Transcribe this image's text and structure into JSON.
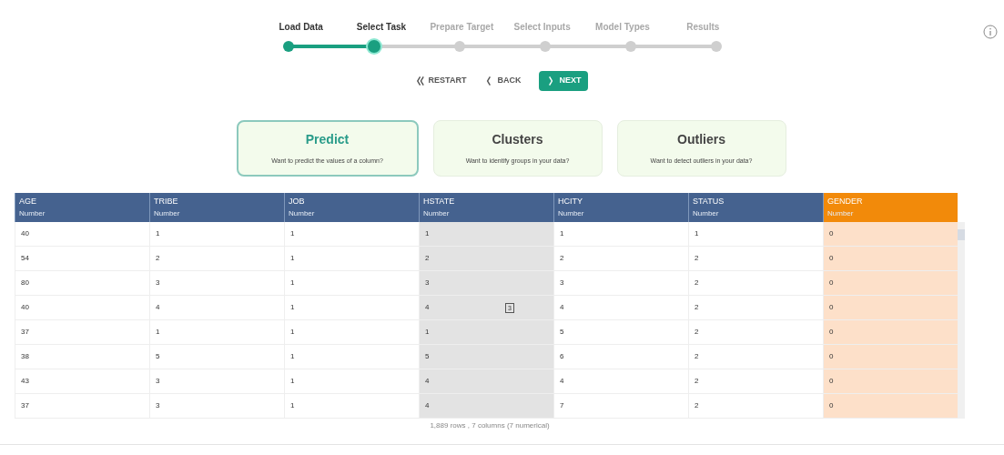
{
  "steps": [
    {
      "label": "Load Data",
      "completed": true,
      "current": false
    },
    {
      "label": "Select Task",
      "completed": true,
      "current": true
    },
    {
      "label": "Prepare Target",
      "completed": false,
      "current": false
    },
    {
      "label": "Select Inputs",
      "completed": false,
      "current": false
    },
    {
      "label": "Model Types",
      "completed": false,
      "current": false
    },
    {
      "label": "Results",
      "completed": false,
      "current": false
    }
  ],
  "nav_buttons": [
    {
      "kind": "restart",
      "label": "RESTART"
    },
    {
      "kind": "back",
      "label": "BACK"
    },
    {
      "kind": "next",
      "label": "NEXT"
    }
  ],
  "tasks": [
    {
      "title": "Predict",
      "description": "Want to predict the values of a column?",
      "selected": true
    },
    {
      "title": "Clusters",
      "description": "Want to identify groups in your data?",
      "selected": false
    },
    {
      "title": "Outliers",
      "description": "Want to detect outliers in your data?",
      "selected": false
    }
  ],
  "table": {
    "columns": [
      {
        "name": "AGE",
        "type": "Number",
        "selected": false,
        "hovered": false
      },
      {
        "name": "TRIBE",
        "type": "Number",
        "selected": false,
        "hovered": false
      },
      {
        "name": "JOB",
        "type": "Number",
        "selected": false,
        "hovered": false
      },
      {
        "name": "HSTATE",
        "type": "Number",
        "selected": false,
        "hovered": true,
        "badge": "3"
      },
      {
        "name": "HCITY",
        "type": "Number",
        "selected": false,
        "hovered": false
      },
      {
        "name": "STATUS",
        "type": "Number",
        "selected": false,
        "hovered": false
      },
      {
        "name": "GENDER",
        "type": "Number",
        "selected": true,
        "hovered": false
      }
    ],
    "rows": [
      [
        "40",
        "1",
        "1",
        "1",
        "1",
        "1",
        "0"
      ],
      [
        "54",
        "2",
        "1",
        "2",
        "2",
        "2",
        "0"
      ],
      [
        "80",
        "3",
        "1",
        "3",
        "3",
        "2",
        "0"
      ],
      [
        "40",
        "4",
        "1",
        "4",
        "4",
        "2",
        "0"
      ],
      [
        "37",
        "1",
        "1",
        "1",
        "5",
        "2",
        "0"
      ],
      [
        "38",
        "5",
        "1",
        "5",
        "6",
        "2",
        "0"
      ],
      [
        "43",
        "3",
        "1",
        "4",
        "4",
        "2",
        "0"
      ],
      [
        "37",
        "3",
        "1",
        "4",
        "7",
        "2",
        "0"
      ]
    ],
    "summary": "1,889 rows , 7 columns (7 numerical)"
  }
}
